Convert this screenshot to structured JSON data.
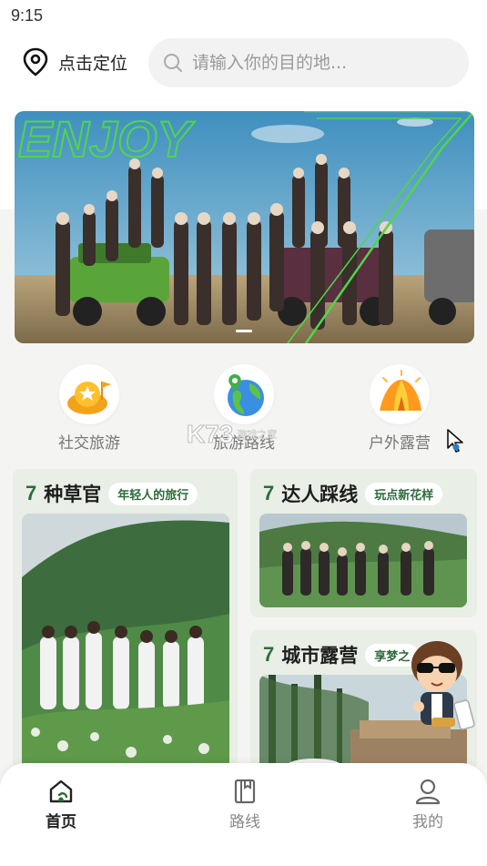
{
  "status_bar": {
    "time": "9:15"
  },
  "header": {
    "location_label": "点击定位",
    "search_placeholder": "请输入你的目的地..."
  },
  "banner": {
    "headline": "ENJOY"
  },
  "categories": [
    {
      "label": "社交旅游",
      "icon": "star-hill-icon"
    },
    {
      "label": "旅游路线",
      "icon": "globe-icon"
    },
    {
      "label": "户外露营",
      "icon": "tent-icon"
    }
  ],
  "watermark": {
    "logo": "K73",
    "text": "游戏之家"
  },
  "cards": [
    {
      "mark": "7",
      "title": "种草官",
      "tag": "年轻人的旅行"
    },
    {
      "mark": "7",
      "title": "达人踩线",
      "tag": "玩点新花样"
    },
    {
      "mark": "7",
      "title": "城市露营",
      "tag": "享梦之"
    }
  ],
  "tabbar": {
    "items": [
      {
        "label": "首页",
        "active": true,
        "icon": "home-icon"
      },
      {
        "label": "路线",
        "active": false,
        "icon": "book-icon"
      },
      {
        "label": "我的",
        "active": false,
        "icon": "user-icon"
      }
    ]
  },
  "colors": {
    "accent_green": "#2e6b3d",
    "neon_green": "#4fd64a",
    "card_bg": "#e9eee6"
  }
}
